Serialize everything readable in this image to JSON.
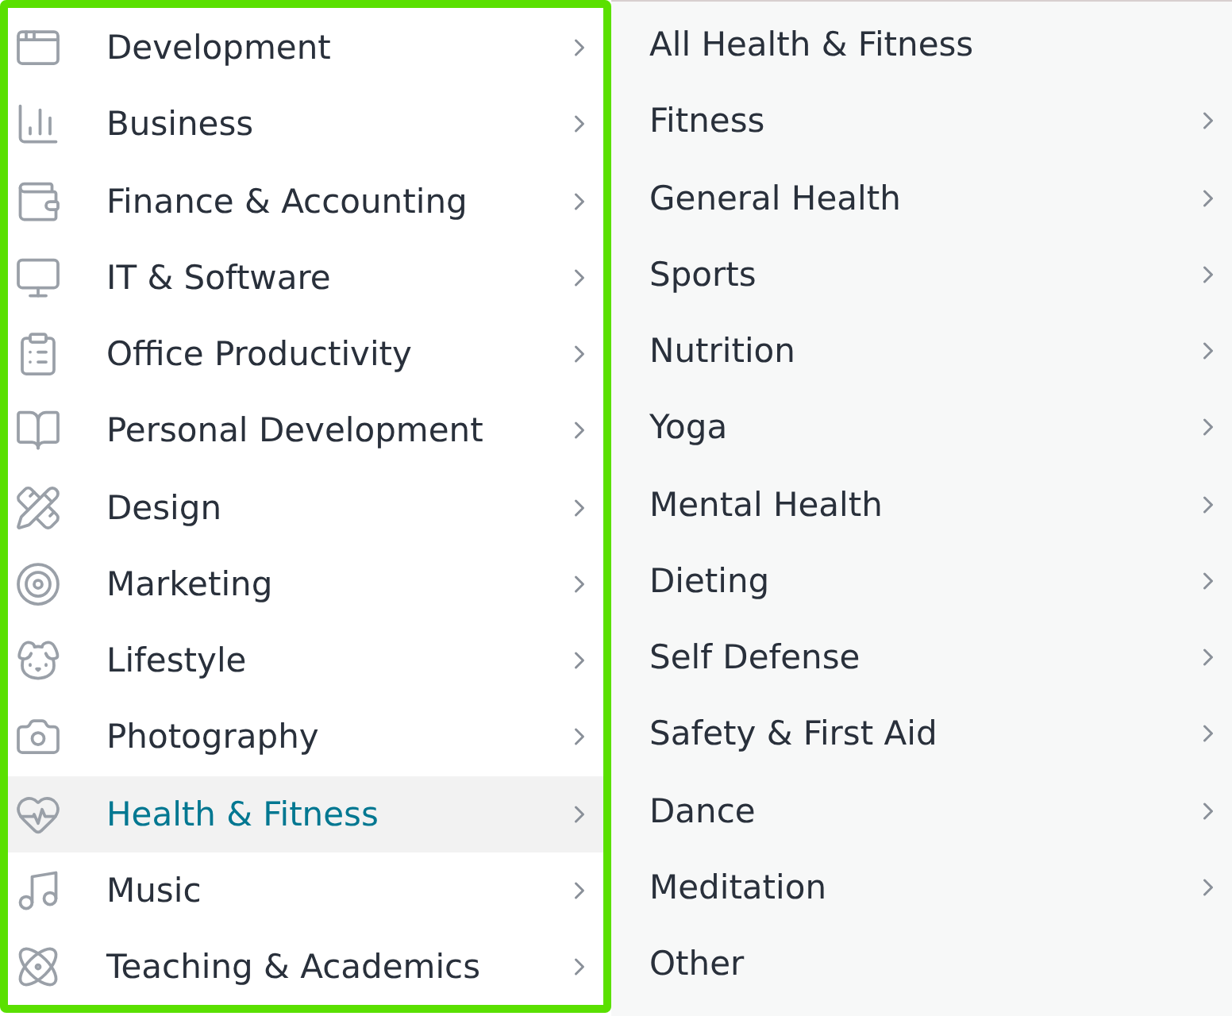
{
  "categories": [
    {
      "label": "Development",
      "selected": false
    },
    {
      "label": "Business",
      "selected": false
    },
    {
      "label": "Finance & Accounting",
      "selected": false
    },
    {
      "label": "IT & Software",
      "selected": false
    },
    {
      "label": "Office Productivity",
      "selected": false
    },
    {
      "label": "Personal Development",
      "selected": false
    },
    {
      "label": "Design",
      "selected": false
    },
    {
      "label": "Marketing",
      "selected": false
    },
    {
      "label": "Lifestyle",
      "selected": false
    },
    {
      "label": "Photography",
      "selected": false
    },
    {
      "label": "Health & Fitness",
      "selected": true
    },
    {
      "label": "Music",
      "selected": false
    },
    {
      "label": "Teaching & Academics",
      "selected": false
    }
  ],
  "subcategories": [
    {
      "label": "All Health & Fitness",
      "has_submenu": false
    },
    {
      "label": "Fitness",
      "has_submenu": true
    },
    {
      "label": "General Health",
      "has_submenu": true
    },
    {
      "label": "Sports",
      "has_submenu": true
    },
    {
      "label": "Nutrition",
      "has_submenu": true
    },
    {
      "label": "Yoga",
      "has_submenu": true
    },
    {
      "label": "Mental Health",
      "has_submenu": true
    },
    {
      "label": "Dieting",
      "has_submenu": true
    },
    {
      "label": "Self Defense",
      "has_submenu": true
    },
    {
      "label": "Safety & First Aid",
      "has_submenu": true
    },
    {
      "label": "Dance",
      "has_submenu": true
    },
    {
      "label": "Meditation",
      "has_submenu": true
    },
    {
      "label": "Other",
      "has_submenu": false
    }
  ]
}
